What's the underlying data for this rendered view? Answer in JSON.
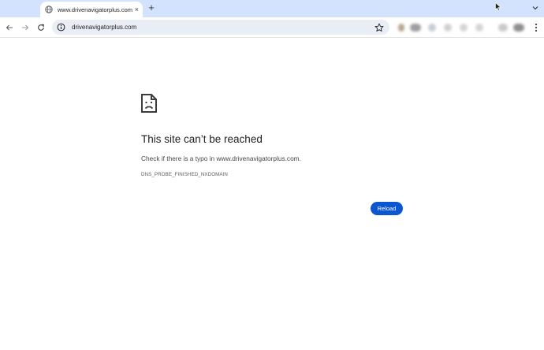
{
  "browser": {
    "tab": {
      "title": "www.drivenavigatorplus.com",
      "favicon": "globe-icon",
      "close_glyph": "×"
    },
    "new_tab_glyph": "+",
    "omnibox": {
      "url": "drivenavigatorplus.com",
      "site_info_icon": "info-icon",
      "bookmark_icon": "star-icon"
    },
    "nav": {
      "back_icon": "back-arrow-icon",
      "forward_icon": "forward-arrow-icon",
      "reload_icon": "reload-icon"
    },
    "menu_icon": "three-dots-icon",
    "colors": {
      "tabstrip": "#d3e3fd",
      "omnibox": "#e9eef6",
      "accent": "#0b57d0"
    }
  },
  "error_page": {
    "icon": "sad-document-icon",
    "title": "This site can’t be reached",
    "suggestion": "Check if there is a typo in www.drivenavigatorplus.com.",
    "error_code": "DNS_PROBE_FINISHED_NXDOMAIN",
    "reload_label": "Reload"
  }
}
